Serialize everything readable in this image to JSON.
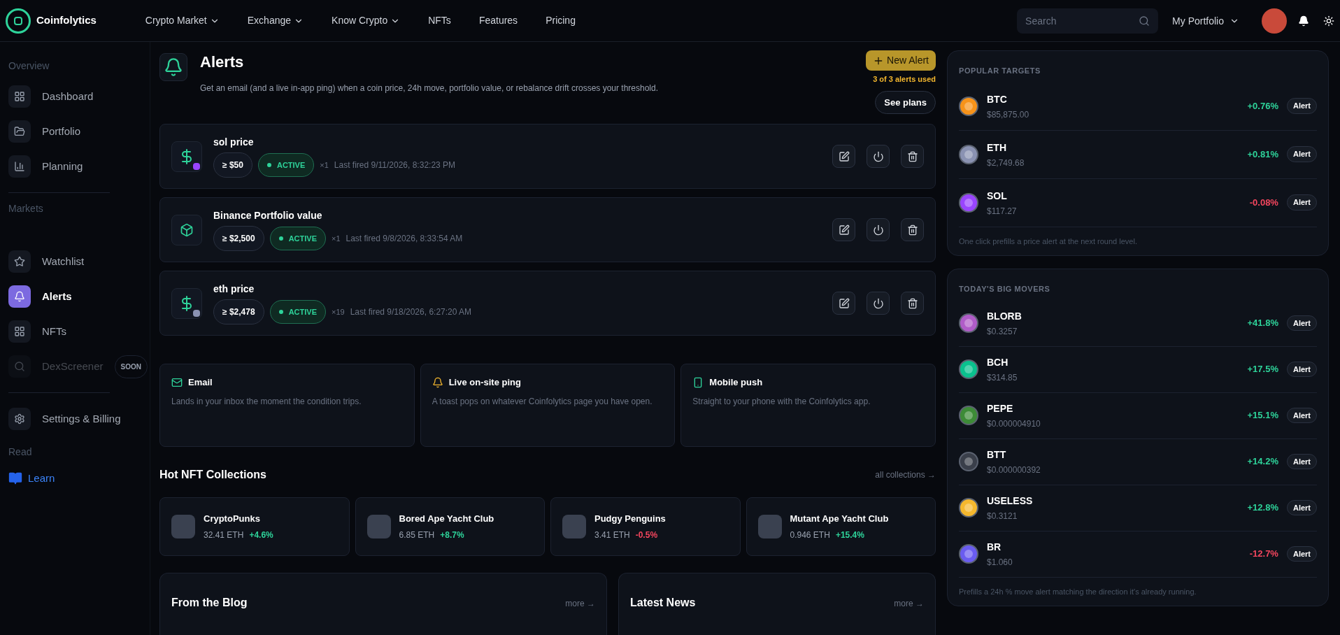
{
  "nav": {
    "brand": "Coinfolytics",
    "menu": [
      {
        "label": "Crypto Market",
        "dropdown": true
      },
      {
        "label": "Exchange",
        "dropdown": true
      },
      {
        "label": "Know Crypto",
        "dropdown": true
      },
      {
        "label": "NFTs",
        "dropdown": false
      },
      {
        "label": "Features",
        "dropdown": false
      },
      {
        "label": "Pricing",
        "dropdown": false
      }
    ],
    "search": {
      "placeholder": "Search"
    },
    "portfolio": "My Portfolio"
  },
  "sidebar": [
    {
      "title": "Overview",
      "divider": true,
      "items": [
        {
          "kind": "dashboard",
          "label": "Dashboard",
          "selected": false,
          "disabled": false
        },
        {
          "kind": "portfolio",
          "label": "Portfolio",
          "selected": false,
          "disabled": false
        },
        {
          "kind": "planning",
          "label": "Planning",
          "selected": false,
          "disabled": false
        }
      ]
    },
    {
      "title": "Markets",
      "divider": true,
      "items": [
        {
          "kind": "watchlist",
          "label": "Watchlist",
          "selected": false,
          "disabled": false
        },
        {
          "kind": "alerts",
          "label": "Alerts",
          "selected": true,
          "disabled": false
        },
        {
          "kind": "nfts",
          "label": "NFTs",
          "selected": false,
          "disabled": false
        },
        {
          "kind": "dexscreener",
          "label": "DexScreener",
          "selected": false,
          "disabled": true,
          "badge": "SOON"
        }
      ]
    },
    {
      "divider": false,
      "items": [
        {
          "kind": "settings",
          "label": "Settings & Billing",
          "selected": false,
          "disabled": false
        }
      ]
    },
    {
      "title": "Read",
      "divider": false,
      "items": [
        {
          "kind": "learn",
          "label": "Learn"
        }
      ]
    }
  ],
  "header": {
    "title": "Alerts",
    "description": "Get an email (and a live in-app ping) when a coin price, 24h move, portfolio value, or rebalance drift crosses your threshold.",
    "new_alert": "New Alert",
    "usage": "3 of 3 alerts used",
    "see_plans": "See plans"
  },
  "alerts": [
    {
      "kind": "price",
      "color": "#9945ff",
      "name": "sol price",
      "threshold": "≥ $50",
      "status": "ACTIVE",
      "active": true,
      "count": "×1",
      "last_fired": "Last fired 9/11/2026, 8:32:23 PM"
    },
    {
      "kind": "portfolio",
      "name": "Binance Portfolio value",
      "threshold": "≥ $2,500",
      "status": "ACTIVE",
      "active": true,
      "count": "×1",
      "last_fired": "Last fired 9/8/2026, 8:33:54 AM"
    },
    {
      "kind": "price",
      "color": "#8a92b2",
      "name": "eth price",
      "threshold": "≥ $2,478",
      "status": "ACTIVE",
      "active": true,
      "count": "×19",
      "last_fired": "Last fired 9/18/2026, 6:27:20 AM"
    }
  ],
  "channels": [
    {
      "kind": "email",
      "title": "Email",
      "text": "Lands in your inbox the moment the condition trips."
    },
    {
      "kind": "ping",
      "title": "Live on-site ping",
      "text": "A toast pops on whatever Coinfolytics page you have open."
    },
    {
      "kind": "mobile",
      "title": "Mobile push",
      "text": "Straight to your phone with the Coinfolytics app."
    }
  ],
  "nft": {
    "title": "Hot NFT Collections",
    "link": "all collections →",
    "items": [
      {
        "kind": "gain",
        "name": "CryptoPunks",
        "price": "32.41 ETH",
        "change": "+4.6%"
      },
      {
        "kind": "gain",
        "name": "Bored Ape Yacht Club",
        "price": "6.85 ETH",
        "change": "+8.7%"
      },
      {
        "kind": "loss",
        "name": "Pudgy Penguins",
        "price": "3.41 ETH",
        "change": "-0.5%"
      },
      {
        "kind": "gain",
        "name": "Mutant Ape Yacht Club",
        "price": "0.946 ETH",
        "change": "+15.4%"
      }
    ]
  },
  "bottom_cards": [
    {
      "title": "From the Blog",
      "link": "more →"
    },
    {
      "title": "Latest News",
      "link": "more →"
    }
  ],
  "popular": {
    "title": "POPULAR TARGETS",
    "note": "One click prefills a price alert at the next round level.",
    "items": [
      {
        "kind": "gain",
        "color": "#f7931a",
        "symbol": "BTC",
        "price": "$85,875.00",
        "change": "+0.76%",
        "button": "Alert"
      },
      {
        "kind": "gain",
        "color": "#8a92b2",
        "symbol": "ETH",
        "price": "$2,749.68",
        "change": "+0.81%",
        "button": "Alert"
      },
      {
        "kind": "loss",
        "color": "#9945ff",
        "symbol": "SOL",
        "price": "$117.27",
        "change": "-0.08%",
        "button": "Alert"
      }
    ]
  },
  "movers": {
    "title": "TODAY'S BIG MOVERS",
    "note": "Prefills a 24h % move alert matching the direction it's already running.",
    "items": [
      {
        "kind": "gain",
        "color": "#b05cc8",
        "symbol": "BLORB",
        "price": "$0.3257",
        "change": "+41.8%",
        "button": "Alert"
      },
      {
        "kind": "gain",
        "color": "#0ac18e",
        "symbol": "BCH",
        "price": "$314.85",
        "change": "+17.5%",
        "button": "Alert"
      },
      {
        "kind": "gain",
        "color": "#3d8b37",
        "symbol": "PEPE",
        "price": "$0.000004910",
        "change": "+15.1%",
        "button": "Alert"
      },
      {
        "kind": "gain",
        "color": "#3a3f4a",
        "symbol": "BTT",
        "price": "$0.000000392",
        "change": "+14.2%",
        "button": "Alert"
      },
      {
        "kind": "gain",
        "color": "#f5b82e",
        "symbol": "USELESS",
        "price": "$0.3121",
        "change": "+12.8%",
        "button": "Alert"
      },
      {
        "kind": "loss",
        "color": "#6a5cf0",
        "symbol": "BR",
        "price": "$1.060",
        "change": "-12.7%",
        "button": "Alert"
      }
    ]
  }
}
